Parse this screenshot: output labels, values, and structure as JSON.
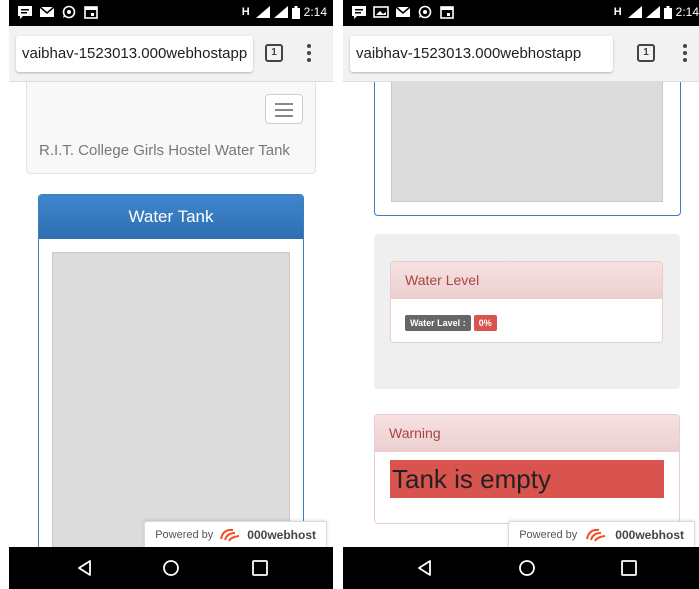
{
  "status_bar": {
    "network": "H",
    "time_left": "2:14",
    "time_right": "2:14",
    "icons": [
      "message-icon",
      "mail-icon",
      "whatsapp-icon",
      "calendar-icon",
      "gallery-icon",
      "signal-icon",
      "battery-icon"
    ]
  },
  "browser": {
    "url": "vaibhav-1523013.000webhostapp",
    "tab_count": "1"
  },
  "left_page": {
    "brand": "R.I.T. College Girls Hostel Water Tank",
    "tank_card_title": "Water Tank"
  },
  "right_page": {
    "water_level_title": "Water Level",
    "water_level_label": "Water Lavel :",
    "water_level_value": "0%",
    "warning_title": "Warning",
    "warning_message": "Tank is empty"
  },
  "footer": {
    "powered_by": "Powered by",
    "host": "000webhost"
  },
  "colors": {
    "primary": "#337ab7",
    "danger": "#d9534f",
    "danger_text": "#a94442"
  }
}
